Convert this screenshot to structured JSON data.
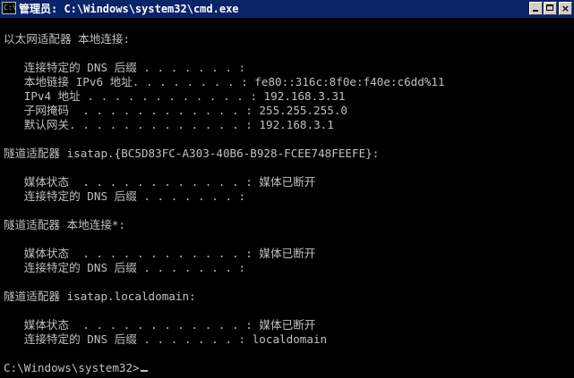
{
  "window": {
    "title": "管理员: C:\\Windows\\system32\\cmd.exe",
    "icon_label": "C:\\",
    "controls": {
      "minimize": "minimize-icon",
      "maximize": "maximize-icon",
      "close": "close-icon"
    }
  },
  "console": {
    "lines": [
      "",
      "以太网适配器 本地连接:",
      "",
      "   连接特定的 DNS 后缀 . . . . . . . :",
      "   本地链接 IPv6 地址. . . . . . . . : fe80::316c:8f0e:f40e:c6dd%11",
      "   IPv4 地址 . . . . . . . . . . . . : 192.168.3.31",
      "   子网掩码  . . . . . . . . . . . . : 255.255.255.0",
      "   默认网关. . . . . . . . . . . . . : 192.168.3.1",
      "",
      "隧道适配器 isatap.{BC5D83FC-A303-40B6-B928-FCEE748FEEFE}:",
      "",
      "   媒体状态  . . . . . . . . . . . . : 媒体已断开",
      "   连接特定的 DNS 后缀 . . . . . . . :",
      "",
      "隧道适配器 本地连接*:",
      "",
      "   媒体状态  . . . . . . . . . . . . : 媒体已断开",
      "   连接特定的 DNS 后缀 . . . . . . . :",
      "",
      "隧道适配器 isatap.localdomain:",
      "",
      "   媒体状态  . . . . . . . . . . . . : 媒体已断开",
      "   连接特定的 DNS 后缀 . . . . . . . : localdomain",
      "",
      "C:\\Windows\\system32>"
    ]
  },
  "colors": {
    "titlebar": "#0a246a",
    "console_bg": "#000000",
    "console_text": "#c0c0c0"
  }
}
